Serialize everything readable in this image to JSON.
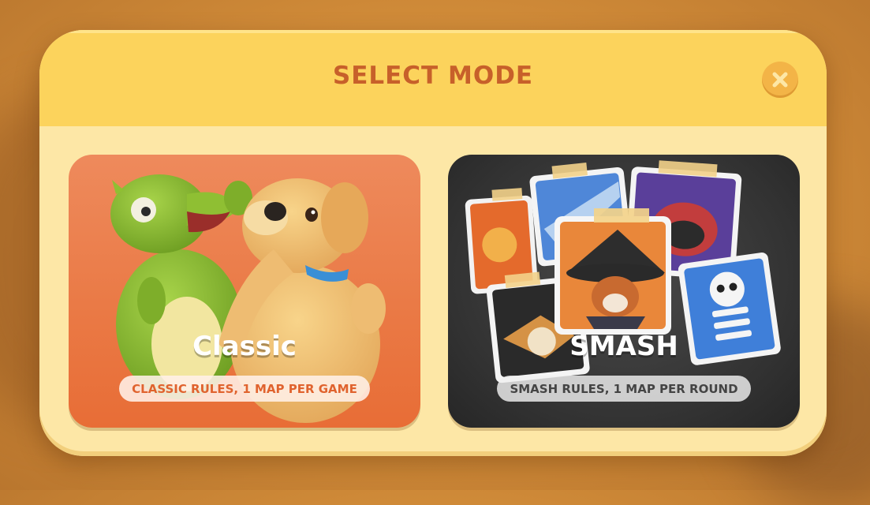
{
  "modal": {
    "title": "SELECT MODE",
    "close_icon": "close-icon"
  },
  "modes": [
    {
      "title": "Classic",
      "subtitle": "CLASSIC RULES, 1 MAP PER GAME",
      "accent": "#ea7a46",
      "art": "dinosaur-and-puppy"
    },
    {
      "title": "SMASH",
      "subtitle": "SMASH RULES, 1 MAP PER ROUND",
      "accent": "#333333",
      "art": "taped-photo-collage"
    }
  ],
  "colors": {
    "header": "#fcd35c",
    "panel": "#fde7a6",
    "title_text": "#c7602a",
    "close_button": "#f3b447"
  }
}
